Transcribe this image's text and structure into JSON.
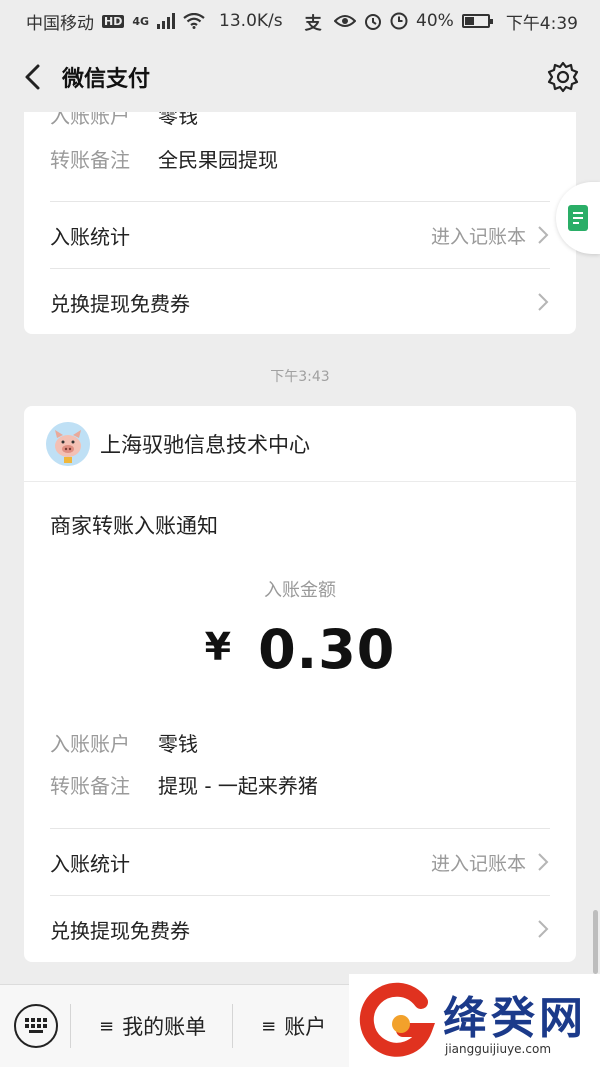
{
  "status_bar": {
    "carrier": "中国移动",
    "hd_badge": "HD",
    "network": "4G",
    "speed": "13.0K/s",
    "alipay_glyph": "支",
    "battery_percent": "40%",
    "battery_level": 0.4,
    "time": "下午4:39"
  },
  "nav": {
    "back_glyph": "〈",
    "title": "微信支付",
    "settings_icon": "gear-icon"
  },
  "card1": {
    "account_label": "入账账户",
    "account_value": "零钱",
    "remark_label": "转账备注",
    "remark_value": "全民果园提现",
    "stats_label": "入账统计",
    "stats_link": "进入记账本",
    "coupon_label": "兑换提现免费券"
  },
  "timestamp": "下午3:43",
  "card2": {
    "merchant_name": "上海驭驰信息技术中心",
    "notice_title": "商家转账入账通知",
    "amount_label": "入账金额",
    "currency": "¥",
    "amount": "0.30",
    "account_label": "入账账户",
    "account_value": "零钱",
    "remark_label": "转账备注",
    "remark_value": "提现 - 一起来养猪",
    "stats_label": "入账统计",
    "stats_link": "进入记账本",
    "coupon_label": "兑换提现免费券"
  },
  "bottom_bar": {
    "menu1": "我的账单",
    "menu2": "账户",
    "burger_glyph": "≡"
  },
  "watermark": {
    "title": "绛癸网",
    "url": "jiangguijiuye.com"
  },
  "colors": {
    "background": "#ededed",
    "card": "#ffffff",
    "accent_green": "#2aae67",
    "muted_text": "#9a9a9a"
  }
}
